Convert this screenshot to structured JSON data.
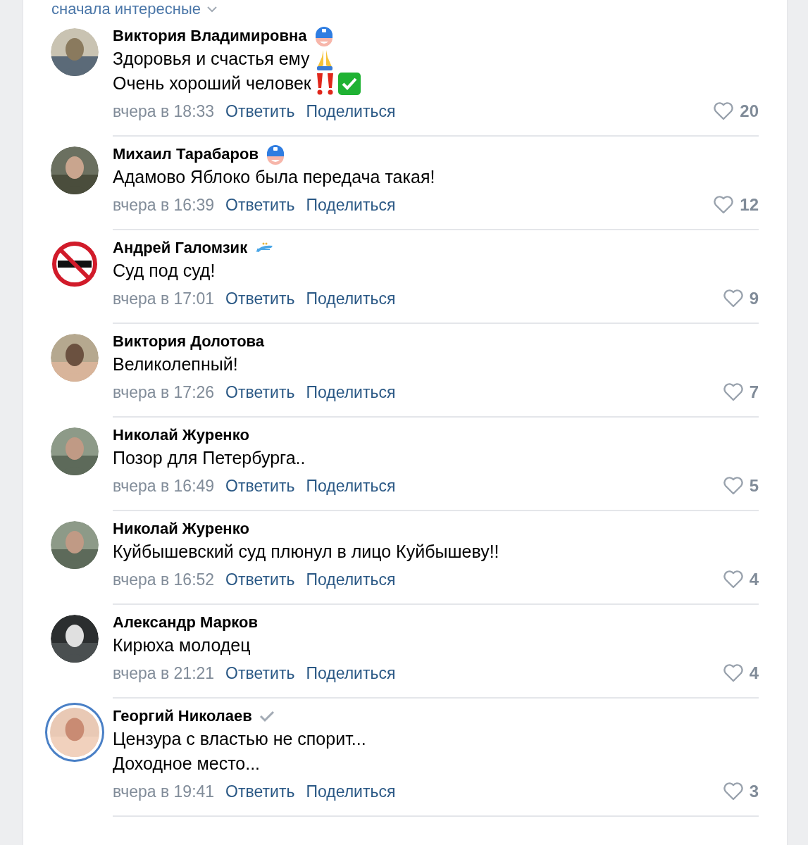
{
  "sort": {
    "label": "сначала интересные"
  },
  "comments": [
    {
      "author": "Виктория Владимировна",
      "badge": {
        "kind": "mask"
      },
      "story_ring": false,
      "lines": [
        {
          "text": "Здоровья и счастья ему",
          "emoji": [
            {
              "kind": "pray"
            }
          ]
        },
        {
          "text": "Очень хороший человек",
          "emoji": [
            {
              "kind": "exclamation"
            },
            {
              "kind": "check"
            }
          ]
        }
      ],
      "time": "вчера в 18:33",
      "reply": "Ответить",
      "share": "Поделиться",
      "likes": "20"
    },
    {
      "author": "Михаил Тарабаров",
      "badge": {
        "kind": "mask"
      },
      "story_ring": false,
      "lines": [
        {
          "text": "Адамово Яблоко была передача такая!"
        }
      ],
      "time": "вчера в 16:39",
      "reply": "Ответить",
      "share": "Поделиться",
      "likes": "12"
    },
    {
      "author": "Андрей Галомзик",
      "badge": {
        "kind": "club"
      },
      "story_ring": false,
      "avatar": {
        "kind": "sign"
      },
      "lines": [
        {
          "text": "Суд под суд!"
        }
      ],
      "time": "вчера в 17:01",
      "reply": "Ответить",
      "share": "Поделиться",
      "likes": "9"
    },
    {
      "author": "Виктория Долотова",
      "story_ring": false,
      "lines": [
        {
          "text": "Великолепный!"
        }
      ],
      "time": "вчера в 17:26",
      "reply": "Ответить",
      "share": "Поделиться",
      "likes": "7"
    },
    {
      "author": "Николай Журенко",
      "story_ring": false,
      "lines": [
        {
          "text": "Позор для Петербурга.."
        }
      ],
      "time": "вчера в 16:49",
      "reply": "Ответить",
      "share": "Поделиться",
      "likes": "5"
    },
    {
      "author": "Николай Журенко",
      "story_ring": false,
      "lines": [
        {
          "text": "Куйбышевский суд плюнул в лицо Куйбышеву!!"
        }
      ],
      "time": "вчера в 16:52",
      "reply": "Ответить",
      "share": "Поделиться",
      "likes": "4"
    },
    {
      "author": "Александр Марков",
      "story_ring": false,
      "lines": [
        {
          "text": "Кирюха молодец"
        }
      ],
      "time": "вчера в 21:21",
      "reply": "Ответить",
      "share": "Поделиться",
      "likes": "4"
    },
    {
      "author": "Георгий Николаев",
      "badge": {
        "kind": "verified"
      },
      "story_ring": true,
      "lines": [
        {
          "text": "Цензура с властью не спорит..."
        },
        {
          "text": "Доходное место..."
        }
      ],
      "time": "вчера в 19:41",
      "reply": "Ответить",
      "share": "Поделиться",
      "likes": "3"
    }
  ]
}
